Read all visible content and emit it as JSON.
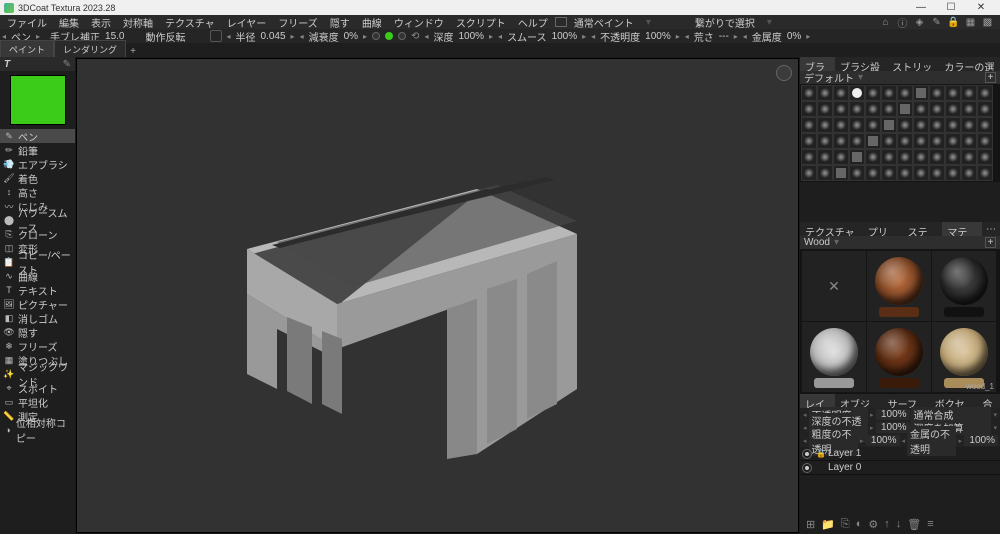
{
  "app": {
    "title": "3DCoat Textura 2023.28"
  },
  "menu": {
    "items": [
      "ファイル",
      "編集",
      "表示",
      "対称軸",
      "テクスチャ",
      "レイヤー",
      "フリーズ",
      "隠す",
      "曲線",
      "ウィンドウ",
      "スクリプト",
      "ヘルプ"
    ],
    "paint_mode": "通常ペイント",
    "select_mode": "繋がりで選択"
  },
  "toolbar": {
    "pen": "ペン",
    "stabilize": "手ブレ補正",
    "stabilize_val": "15.0",
    "motion": "動作反転",
    "radius": "半径",
    "radius_val": "0.045",
    "falloff": "減衰度",
    "falloff_val": "0%",
    "depth": "深度",
    "depth_val": "100%",
    "smooth": "スムース",
    "smooth_val": "100%",
    "opacity": "不透明度",
    "opacity_val": "100%",
    "rough": "荒さ",
    "rough_val": "---",
    "metal": "金属度",
    "metal_val": "0%"
  },
  "workspace_tabs": [
    "ペイント",
    "レンダリング"
  ],
  "left": {
    "header_t": "T",
    "tools": [
      {
        "icon": "✎",
        "label": "ペン",
        "active": true
      },
      {
        "icon": "✏",
        "label": "鉛筆"
      },
      {
        "icon": "💨",
        "label": "エアブラシ"
      },
      {
        "icon": "🖌",
        "label": "着色"
      },
      {
        "icon": "↕",
        "label": "高さ"
      },
      {
        "icon": "〰",
        "label": "にじみ"
      },
      {
        "icon": "⬤",
        "label": "パワースムース"
      },
      {
        "icon": "⎘",
        "label": "クローン"
      },
      {
        "icon": "◫",
        "label": "変形"
      },
      {
        "icon": "📋",
        "label": "コピー/ペースト"
      },
      {
        "icon": "∿",
        "label": "曲線"
      },
      {
        "icon": "T",
        "label": "テキスト"
      },
      {
        "icon": "🖼",
        "label": "ピクチャー"
      },
      {
        "icon": "◧",
        "label": "消しゴム"
      },
      {
        "icon": "👁",
        "label": "隠す"
      },
      {
        "icon": "❄",
        "label": "フリーズ"
      },
      {
        "icon": "▦",
        "label": "塗りつぶし"
      },
      {
        "icon": "✨",
        "label": "マジックワンド"
      },
      {
        "icon": "⌖",
        "label": "スポイト"
      },
      {
        "icon": "▭",
        "label": "平坦化"
      },
      {
        "icon": "📏",
        "label": "測定"
      },
      {
        "icon": "◑",
        "label": "位相対称コピー"
      }
    ]
  },
  "right": {
    "brush_tabs": [
      "ブラシ",
      "ブラシ設定",
      "ストリップ",
      "カラーの選択"
    ],
    "brush_preset": "デフォルト",
    "mat_tabs": [
      "テクスチャエディタ",
      "プリセット",
      "ステンシル",
      "マテリアル"
    ],
    "mat_category": "Wood",
    "mat_selected": "wood_1",
    "layer_tabs": [
      "レイヤー",
      "オブジェクト",
      "サーフェイス",
      "ボクセルツリ",
      "合成"
    ],
    "layer_props": {
      "opacity_l": "不透明度",
      "opacity_v": "100%",
      "blend": "通常合成",
      "depth_l": "深度の不透明",
      "depth_v": "100%",
      "depth_mode": "深度を加算",
      "rough_l": "粗度の不透明",
      "rough_v": "100%",
      "metal_l": "金属の不透明",
      "metal_v": "100%"
    },
    "layers": [
      {
        "name": "Layer 1",
        "visible": true,
        "locked": true
      },
      {
        "name": "Layer 0",
        "visible": true,
        "locked": false
      }
    ]
  }
}
